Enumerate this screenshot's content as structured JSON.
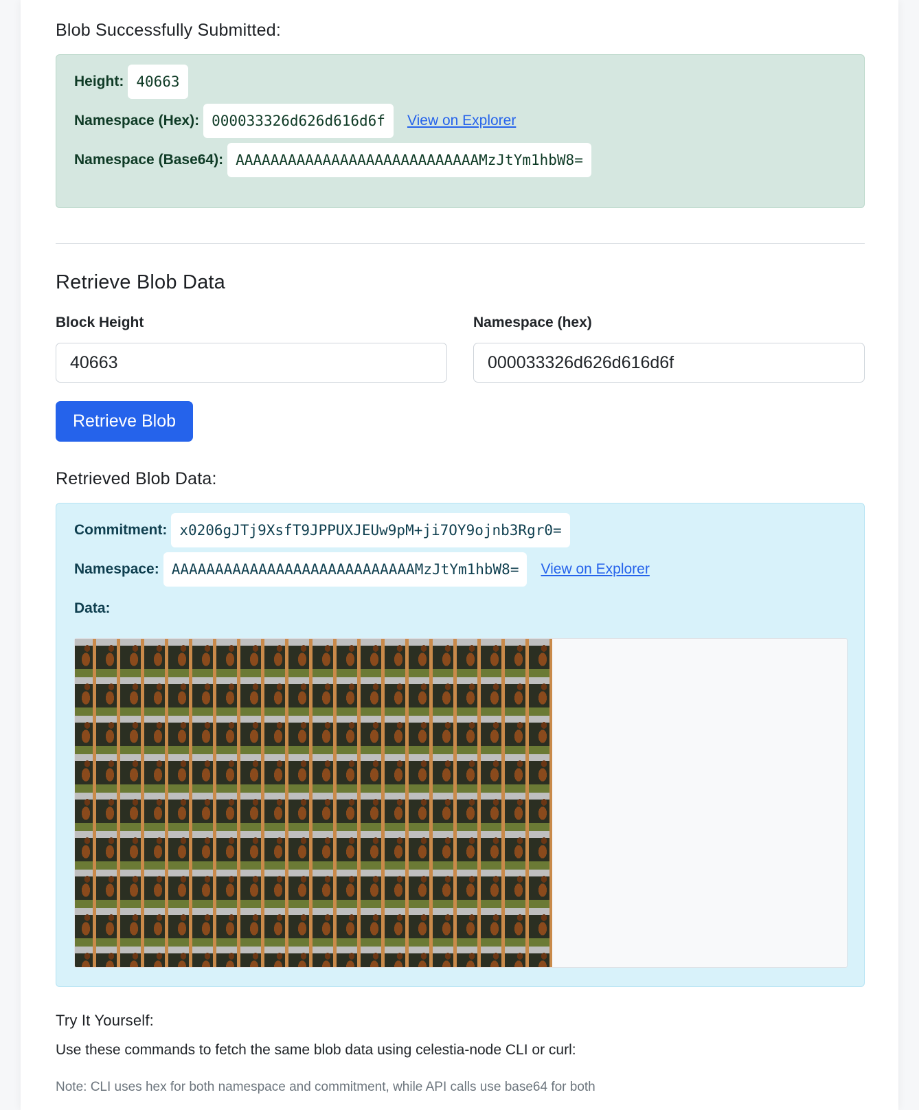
{
  "submitted": {
    "heading": "Blob Successfully Submitted:",
    "height_label": "Height:",
    "height_value": "40663",
    "ns_hex_label": "Namespace (Hex):",
    "ns_hex_value": "000033326d626d616d6f",
    "explorer_link": "View on Explorer",
    "ns_b64_label": "Namespace (Base64):",
    "ns_b64_value": "AAAAAAAAAAAAAAAAAAAAAAAAAAAAMzJtYm1hbW8="
  },
  "retrieve": {
    "heading": "Retrieve Blob Data",
    "block_height_label": "Block Height",
    "block_height_value": "40663",
    "namespace_label": "Namespace (hex)",
    "namespace_value": "000033326d626d616d6f",
    "button_label": "Retrieve Blob"
  },
  "retrieved": {
    "heading": "Retrieved Blob Data:",
    "commitment_label": "Commitment:",
    "commitment_value": "x0206gJTj9XsfT9JPPUXJEUw9pM+ji7OY9ojnb3Rgr0=",
    "namespace_label": "Namespace:",
    "namespace_value": "AAAAAAAAAAAAAAAAAAAAAAAAAAAAMzJtYm1hbW8=",
    "explorer_link": "View on Explorer",
    "data_label": "Data:"
  },
  "try": {
    "heading": "Try It Yourself:",
    "description": "Use these commands to fetch the same blob data using celestia-node CLI or curl:",
    "note": "Note: CLI uses hex for both namespace and commitment, while API calls use base64 for both"
  },
  "colors": {
    "primary": "#2563eb",
    "success_bg": "#d5e7e0",
    "info_bg": "#d8f2fa"
  }
}
